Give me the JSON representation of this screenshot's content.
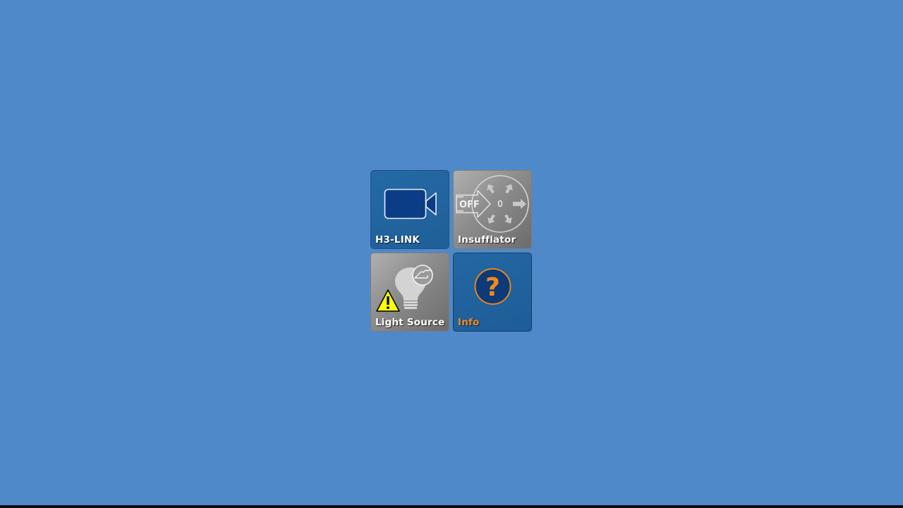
{
  "tiles": {
    "h3link": {
      "label": "H3-LINK",
      "icon": "video-camera-icon"
    },
    "insufflator": {
      "label": "Insufflator",
      "status_text": "OFF",
      "pressure_value": "0",
      "icon": "insufflator-flow-icon"
    },
    "light_source": {
      "label": "Light Source",
      "icon": "light-bulb-icon",
      "warning_icon": "warning-triangle-icon",
      "badge_icon": "hand-icon"
    },
    "info": {
      "label": "Info",
      "icon": "question-mark-icon"
    }
  },
  "colors": {
    "desktop_background": "#5089c9",
    "tile_blue": "#2367a3",
    "tile_gray": "#8c8c8c",
    "accent_orange": "#f28a1c",
    "warning_yellow": "#ffff00",
    "camera_fill": "#0b3d86"
  }
}
